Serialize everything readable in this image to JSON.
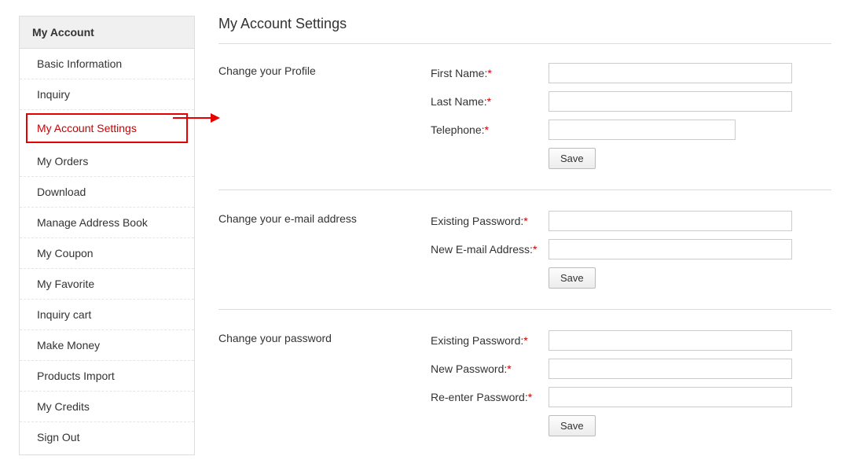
{
  "sidebar": {
    "header": "My Account",
    "items": [
      "Basic Information",
      "Inquiry",
      "My Account Settings",
      "My Orders",
      "Download",
      "Manage Address Book",
      "My Coupon",
      "My Favorite",
      "Inquiry cart",
      "Make Money",
      "Products Import",
      "My Credits",
      "Sign Out"
    ],
    "active_index": 2
  },
  "main": {
    "title": "My Account Settings",
    "sections": {
      "profile": {
        "title": "Change your Profile",
        "first_name_label": "First Name:",
        "last_name_label": "Last Name:",
        "telephone_label": "Telephone:",
        "first_name_value": "",
        "last_name_value": "",
        "telephone_value": "",
        "save_label": "Save"
      },
      "email": {
        "title": "Change your e-mail address",
        "existing_password_label": "Existing Password:",
        "new_email_label": "New E-mail Address:",
        "existing_password_value": "",
        "new_email_value": "",
        "save_label": "Save"
      },
      "password": {
        "title": "Change your password",
        "existing_password_label": "Existing Password:",
        "new_password_label": "New Password:",
        "reenter_password_label": "Re-enter Password:",
        "existing_password_value": "",
        "new_password_value": "",
        "reenter_password_value": "",
        "save_label": "Save"
      }
    }
  },
  "required_marker": "*",
  "colors": {
    "accent_red": "#c00",
    "highlight_border": "#e60000"
  }
}
